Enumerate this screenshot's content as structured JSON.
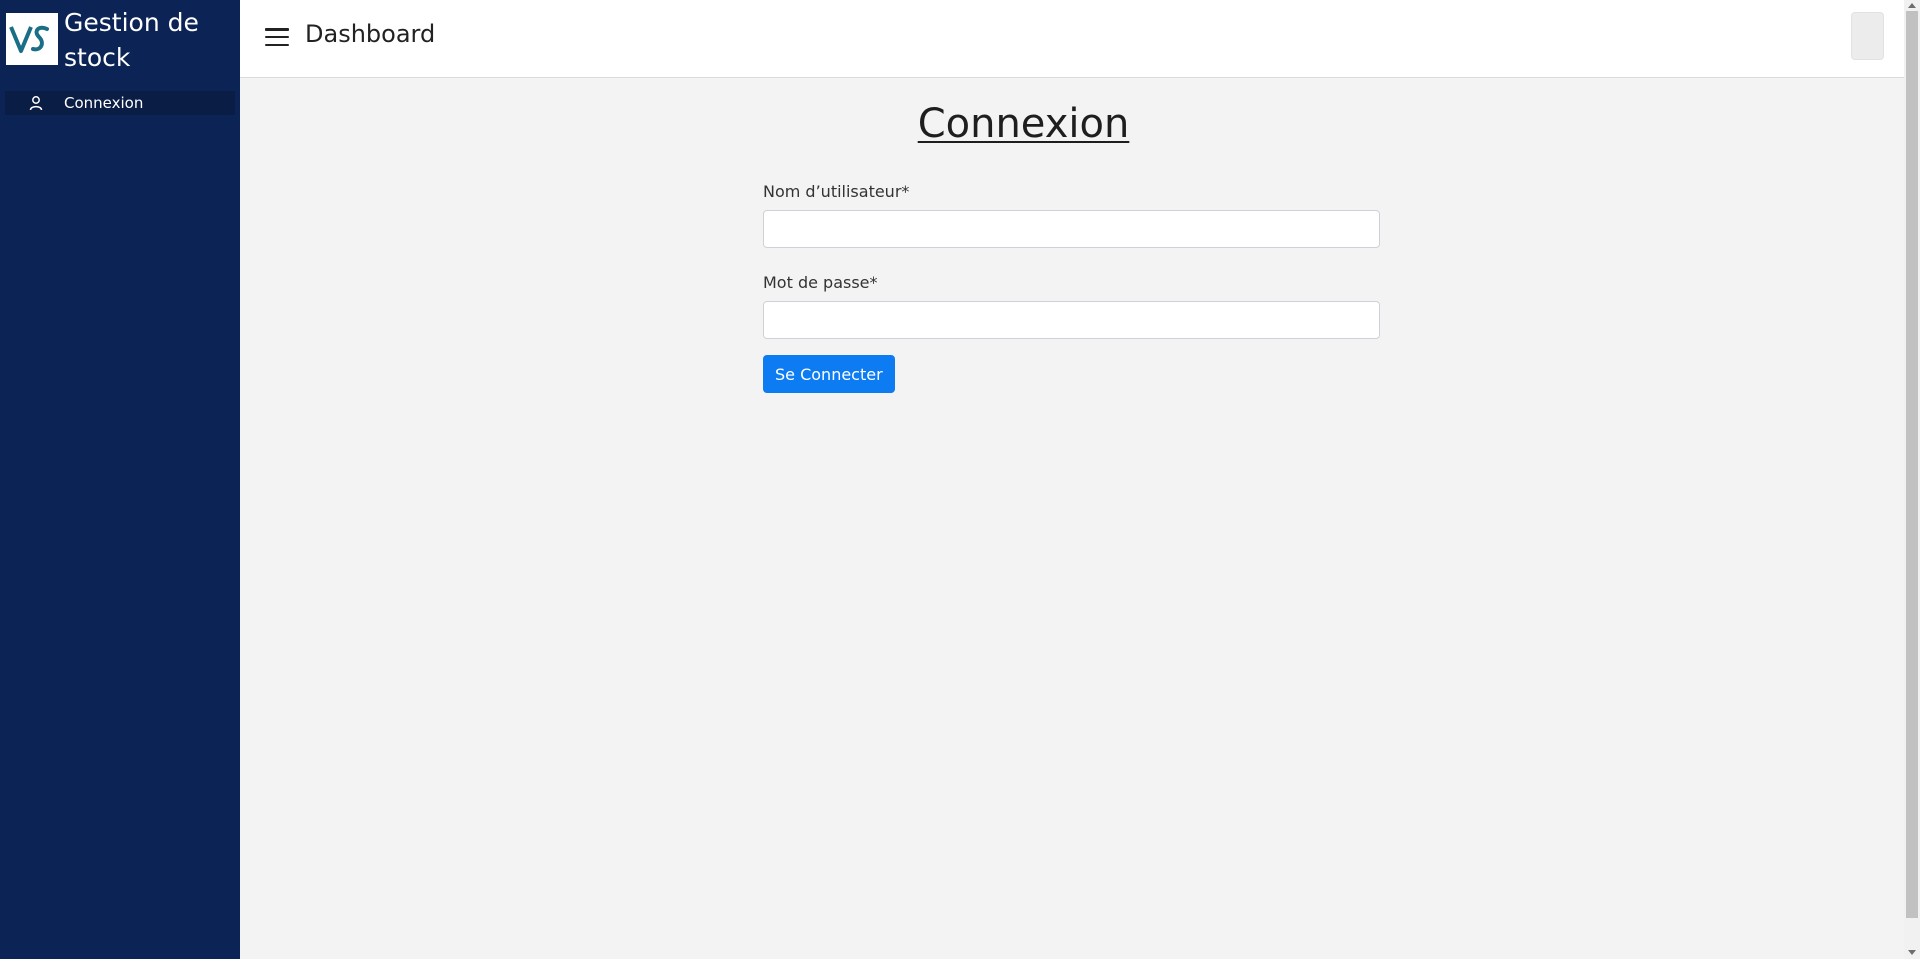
{
  "sidebar": {
    "brand_title": "Gestion de stock",
    "logo_icon": "vs-logo-icon",
    "items": [
      {
        "label": "Connexion",
        "icon": "user-icon",
        "active": true
      }
    ]
  },
  "header": {
    "menu_icon": "hamburger-menu-icon",
    "title": "Dashboard"
  },
  "main": {
    "title": "Connexion",
    "form": {
      "username_label": "Nom d’utilisateur*",
      "username_value": "",
      "password_label": "Mot de passe*",
      "password_value": "",
      "submit_label": "Se Connecter"
    }
  },
  "colors": {
    "sidebar_bg": "#0b2355",
    "primary": "#0d7cf2",
    "content_bg": "#f3f3f3"
  }
}
